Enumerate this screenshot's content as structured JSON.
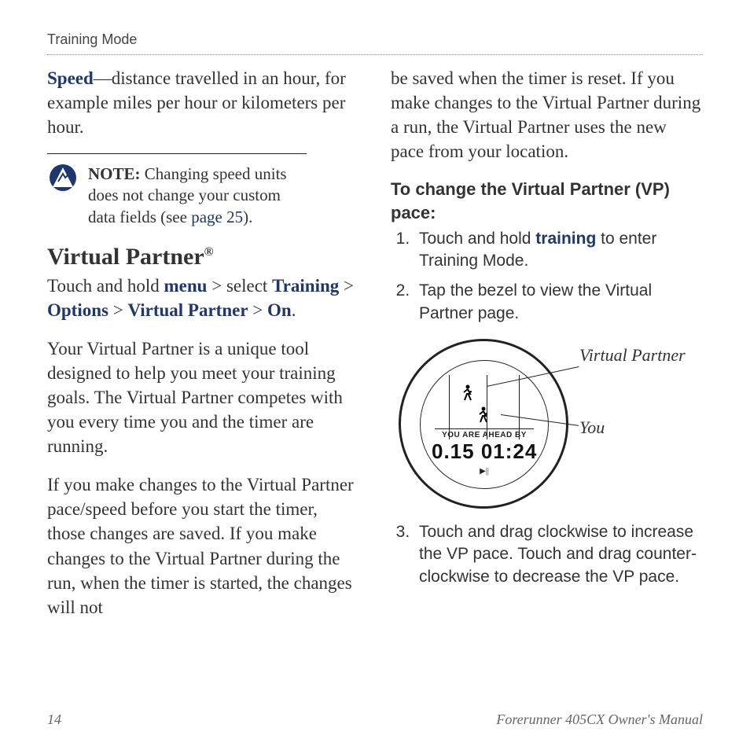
{
  "running_head": "Training Mode",
  "left": {
    "speed_term": "Speed",
    "speed_def": "—distance travelled in an hour, for example miles per hour or kilometers per hour.",
    "note_label": "NOTE:",
    "note_before": " Changing speed units does not change your custom data fields (see ",
    "note_link": "page 25",
    "note_after": ").",
    "vp_heading": "Virtual Partner",
    "vp_reg": "®",
    "path_intro": "Touch and hold ",
    "path_menu": "menu",
    "path_sep1": " > select ",
    "path_training": "Training",
    "path_sep2": " > ",
    "path_options": "Options",
    "path_sep3": " > ",
    "path_vp": "Virtual Partner",
    "path_sep4": " > ",
    "path_on": "On",
    "path_end": ".",
    "para1": "Your Virtual Partner is a unique tool designed to help you meet your training goals. The Virtual Partner competes with you every time you and the timer are running.",
    "para2": "If you make changes to the Virtual Partner pace/speed before you start the timer, those changes are saved. If you make changes to the Virtual Partner during the run, when the timer is started, the changes will not"
  },
  "right": {
    "cont": "be saved when the timer is reset. If you make changes to the Virtual Partner during a run, the Virtual Partner uses the new pace from your location.",
    "subhead": "To change the Virtual Partner (VP) pace:",
    "steps": {
      "s1a": "Touch and hold ",
      "s1b": "training",
      "s1c": " to enter Training Mode.",
      "s2": "Tap the bezel to view the Virtual Partner page.",
      "s3": "Touch and drag clockwise to increase the VP pace. Touch and drag counter-clockwise to decrease the VP pace."
    },
    "watch": {
      "status": "YOU ARE AHEAD BY",
      "dist": "0.15",
      "time": "01:24",
      "label_vp": "Virtual Partner",
      "label_you": "You"
    }
  },
  "footer": {
    "page": "14",
    "title": "Forerunner 405CX Owner's Manual"
  }
}
